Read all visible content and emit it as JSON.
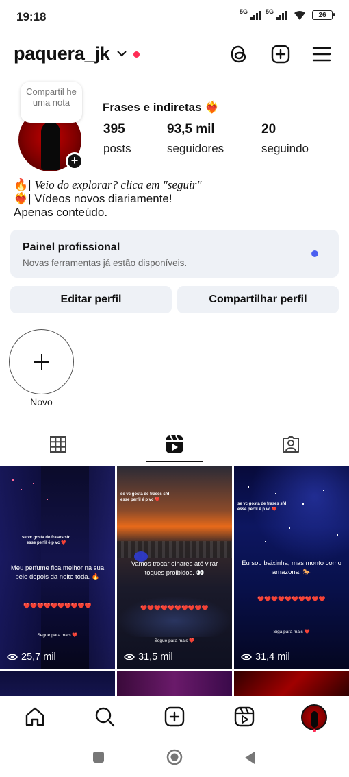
{
  "status_bar": {
    "time": "19:18",
    "network1": "5G",
    "network2": "5G",
    "battery": "26"
  },
  "header": {
    "username": "paquera_jk",
    "icons": [
      "chevron-down-icon",
      "threads-icon",
      "create-icon",
      "menu-icon"
    ]
  },
  "profile": {
    "note_text": "Compartil he uma nota",
    "display_name": "Frases e indiretas ❤️‍🔥",
    "stats": [
      {
        "value": "395",
        "label": "posts"
      },
      {
        "value": "93,5 mil",
        "label": "seguidores"
      },
      {
        "value": "20",
        "label": "seguindo"
      }
    ],
    "bio_line1_emoji": "🔥|",
    "bio_line1": "Veio do explorar? clica em \"seguir\"",
    "bio_line2": "❤️‍🔥| Vídeos novos diariamente!",
    "bio_line3": "Apenas conteúdo."
  },
  "panel": {
    "title": "Painel profissional",
    "subtitle": "Novas ferramentas já estão disponíveis.",
    "accent": "#4a5ff0"
  },
  "buttons": {
    "edit": "Editar perfil",
    "share": "Compartilhar perfil"
  },
  "highlights": {
    "new_label": "Novo"
  },
  "tabs": [
    "grid-icon",
    "reels-icon",
    "tagged-icon"
  ],
  "reels": [
    {
      "top_small": "se vc gosta de frases sfd\nesse perfil é p vc ❤️",
      "caption": "Meu perfume fica melhor na sua pele depois da noite toda. 🔥",
      "hearts": "❤️❤️❤️❤️❤️❤️❤️❤️❤️❤️",
      "follow": "Segue para mais ❤️",
      "views": "25,7 mil"
    },
    {
      "top_small": "se vc gosta de frases sfd\nesse perfil é p vc ❤️",
      "caption": "Vamos trocar olhares até virar toques proibidos. 👀",
      "hearts": "❤️❤️❤️❤️❤️❤️❤️❤️❤️❤️",
      "follow": "Segue para mais ❤️",
      "views": "31,5 mil"
    },
    {
      "top_small": "se vc gosta de frases sfd\nesse perfil é p vc ❤️",
      "caption": "Eu sou baixinha, mas monto como amazona. 🐎",
      "hearts": "❤️❤️❤️❤️❤️❤️❤️❤️❤️❤️",
      "follow": "Siga para mais ❤️",
      "views": "31,4 mil"
    }
  ],
  "bottom_nav": [
    "home-icon",
    "search-icon",
    "create-icon",
    "reels-icon",
    "profile-avatar"
  ]
}
